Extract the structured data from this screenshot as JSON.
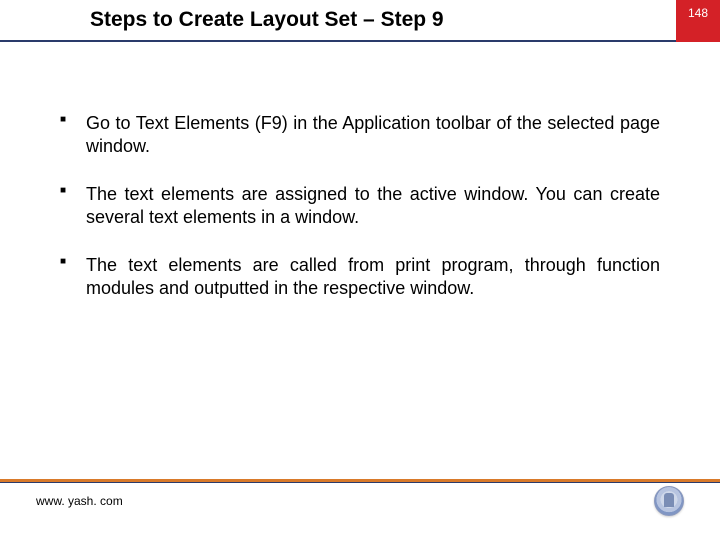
{
  "header": {
    "title": "Steps to Create Layout Set – Step 9",
    "page_number": "148"
  },
  "bullets": [
    "Go to Text Elements (F9) in the Application toolbar of the selected page window.",
    "The text elements are assigned to the active window. You can create several text elements in a window.",
    "The text elements are called from print program, through function modules and outputted in the respective window."
  ],
  "footer": {
    "url": "www. yash. com"
  }
}
